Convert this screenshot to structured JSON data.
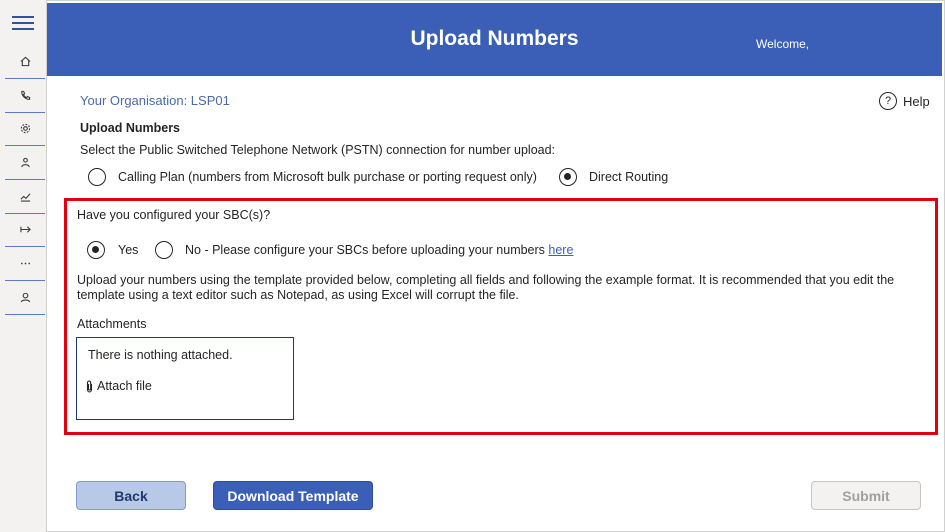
{
  "header": {
    "title": "Upload Numbers",
    "welcome": "Welcome,"
  },
  "sidebar": {
    "items": [
      {
        "icon": "home-icon"
      },
      {
        "icon": "phone-icon"
      },
      {
        "icon": "gear-icon"
      },
      {
        "icon": "user-icon"
      },
      {
        "icon": "chart-icon"
      },
      {
        "icon": "arrow-right-icon"
      },
      {
        "icon": "more-icon"
      },
      {
        "icon": "account-icon"
      }
    ]
  },
  "page": {
    "organisation": "Your Organisation: LSP01",
    "help_label": "Help",
    "help_glyph": "?",
    "section_title": "Upload Numbers",
    "pstn_prompt": "Select the Public Switched Telephone Network (PSTN) connection for number upload:",
    "pstn_options": [
      {
        "label": "Calling Plan (numbers from Microsoft bulk purchase or porting request only)",
        "selected": false
      },
      {
        "label": "Direct Routing",
        "selected": true
      }
    ],
    "sbc_question": "Have you configured your SBC(s)?",
    "sbc_options": [
      {
        "label": "Yes",
        "selected": true
      },
      {
        "label": "No - Please configure your SBCs before uploading your numbers",
        "selected": false
      }
    ],
    "sbc_link": "here",
    "instructions": "Upload your numbers using the template provided below, completing all fields and following the example format. It is recommended that you edit the template using a text editor such as Notepad, as using Excel will corrupt the file.",
    "attachments_label": "Attachments",
    "attachments_empty": "There is nothing attached.",
    "attach_file": "Attach file"
  },
  "buttons": {
    "back": "Back",
    "download": "Download Template",
    "submit": "Submit"
  },
  "colors": {
    "header": "#3b5fb7",
    "highlight": "#e3000f",
    "link": "#3b5fb7"
  }
}
